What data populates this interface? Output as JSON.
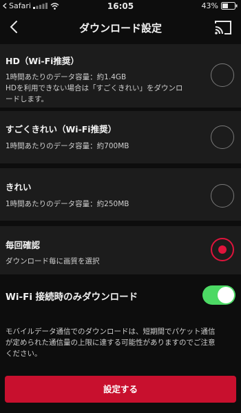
{
  "status_bar": {
    "carrier": "Safari",
    "time": "16:05",
    "battery": "43%"
  },
  "header": {
    "title": "ダウンロード設定",
    "back_icon": "chevron-left-icon",
    "cast_icon": "cast-icon"
  },
  "options": [
    {
      "title": "HD（Wi-Fi推奨）",
      "lines": [
        "1時間あたりのデータ容量：約1.4GB",
        "HDを利用できない場合は「すごくきれい」をダウンロ",
        "ードします。"
      ],
      "selected": false
    },
    {
      "title": "すごくきれい（Wi-Fi推奨）",
      "lines": [
        "1時間あたりのデータ容量：約700MB"
      ],
      "selected": false
    },
    {
      "title": "きれい",
      "lines": [
        "1時間あたりのデータ容量：約250MB"
      ],
      "selected": false
    },
    {
      "title": "毎回確認",
      "lines": [
        "ダウンロード毎に画質を選択"
      ],
      "selected": true
    }
  ],
  "wifi_only": {
    "label": "Wi-Fi 接続時のみダウンロード",
    "enabled": true
  },
  "notice_lines": [
    "モバイルデータ通信でのダウンロードは、短期間でパケット通信",
    "が定められた通信量の上限に達する可能性がありますのでご注意",
    "ください。"
  ],
  "submit_label": "設定する",
  "colors": {
    "accent": "#e0143c",
    "button": "#c8102e",
    "toggle_on": "#4cd964"
  }
}
